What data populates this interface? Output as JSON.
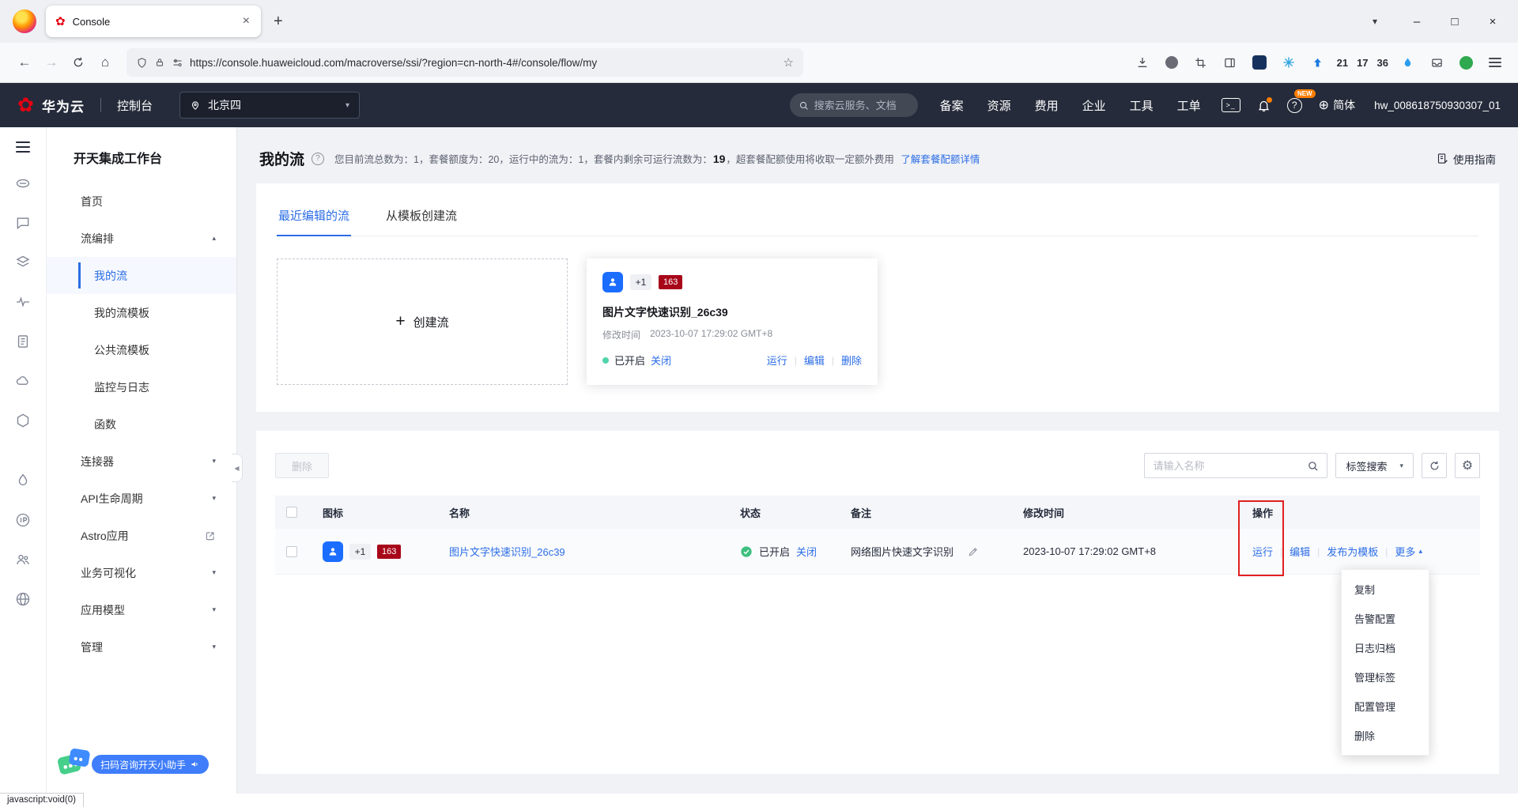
{
  "icons": {
    "back": "←",
    "forward": "→",
    "home": "⌂",
    "star": "☆",
    "close": "×",
    "minimize": "–",
    "maximize": "□",
    "chevron_down": "▾",
    "chevron_up": "▴",
    "plus": "+",
    "gear": "⚙",
    "flower": "✿",
    "globe": "⊕",
    "collapse": "◀",
    "terminal": ">_",
    "pipe": "|",
    "question": "?"
  },
  "browser": {
    "tab_title": "Console",
    "url": "https://console.huaweicloud.com/macroverse/ssi/?region=cn-north-4#/console/flow/my",
    "counts": [
      "21",
      "17",
      "36"
    ],
    "status_text": "javascript:void(0)"
  },
  "topnav": {
    "brand": "华为云",
    "console_label": "控制台",
    "region": "北京四",
    "search_placeholder": "搜索云服务、文档",
    "menu": [
      "备案",
      "资源",
      "费用",
      "企业",
      "工具",
      "工单"
    ],
    "lang": "简体",
    "new_badge": "NEW",
    "user": "hw_008618750930307_01"
  },
  "sidebar": {
    "title": "开天集成工作台",
    "home": "首页",
    "flow_group": "流编排",
    "my_flows": "我的流",
    "my_templates": "我的流模板",
    "public_templates": "公共流模板",
    "monitor": "监控与日志",
    "functions": "函数",
    "connectors": "连接器",
    "api_lifecycle": "API生命周期",
    "astro": "Astro应用",
    "biz_visual": "业务可视化",
    "app_model": "应用模型",
    "manage": "管理"
  },
  "page": {
    "title": "我的流",
    "stats_1": "您目前流总数为：1，套餐额度为：20，运行中的流为：1，套餐内剩余可运行流数为：",
    "stats_value": "19",
    "stats_2": "，超套餐配额使用将收取一定额外费用",
    "stats_link": "了解套餐配额详情",
    "guide": "使用指南"
  },
  "tabs": {
    "recent": "最近编辑的流",
    "from_template": "从模板创建流"
  },
  "create_card": {
    "label": "创建流"
  },
  "flow": {
    "plus_chip": "+1",
    "count_badge": "163",
    "name": "图片文字快速识别_26c39",
    "time_label": "修改时间",
    "time": "2023-10-07 17:29:02 GMT+8",
    "status": "已开启",
    "toggle": "关闭",
    "remark": "网络图片快速文字识别"
  },
  "card_actions": {
    "run": "运行",
    "edit": "编辑",
    "del": "删除"
  },
  "toolbar": {
    "del": "删除",
    "search_placeholder": "请输入名称",
    "tag_search": "标签搜索"
  },
  "table": {
    "headers": {
      "icon": "图标",
      "name": "名称",
      "status": "状态",
      "remark": "备注",
      "time": "修改时间",
      "action": "操作"
    },
    "actions": {
      "run": "运行",
      "edit": "编辑",
      "publish": "发布为模板",
      "more": "更多"
    }
  },
  "dropdown": [
    "复制",
    "告警配置",
    "日志归档",
    "管理标签",
    "配置管理",
    "删除"
  ],
  "assistant": {
    "label": "扫码咨询开天小助手"
  },
  "colors": {
    "accent": "#2b6de5",
    "success": "#3fbf7f",
    "badge_red": "#a8071a",
    "annotation": "#e02020",
    "nav_bg": "#252b3a"
  }
}
